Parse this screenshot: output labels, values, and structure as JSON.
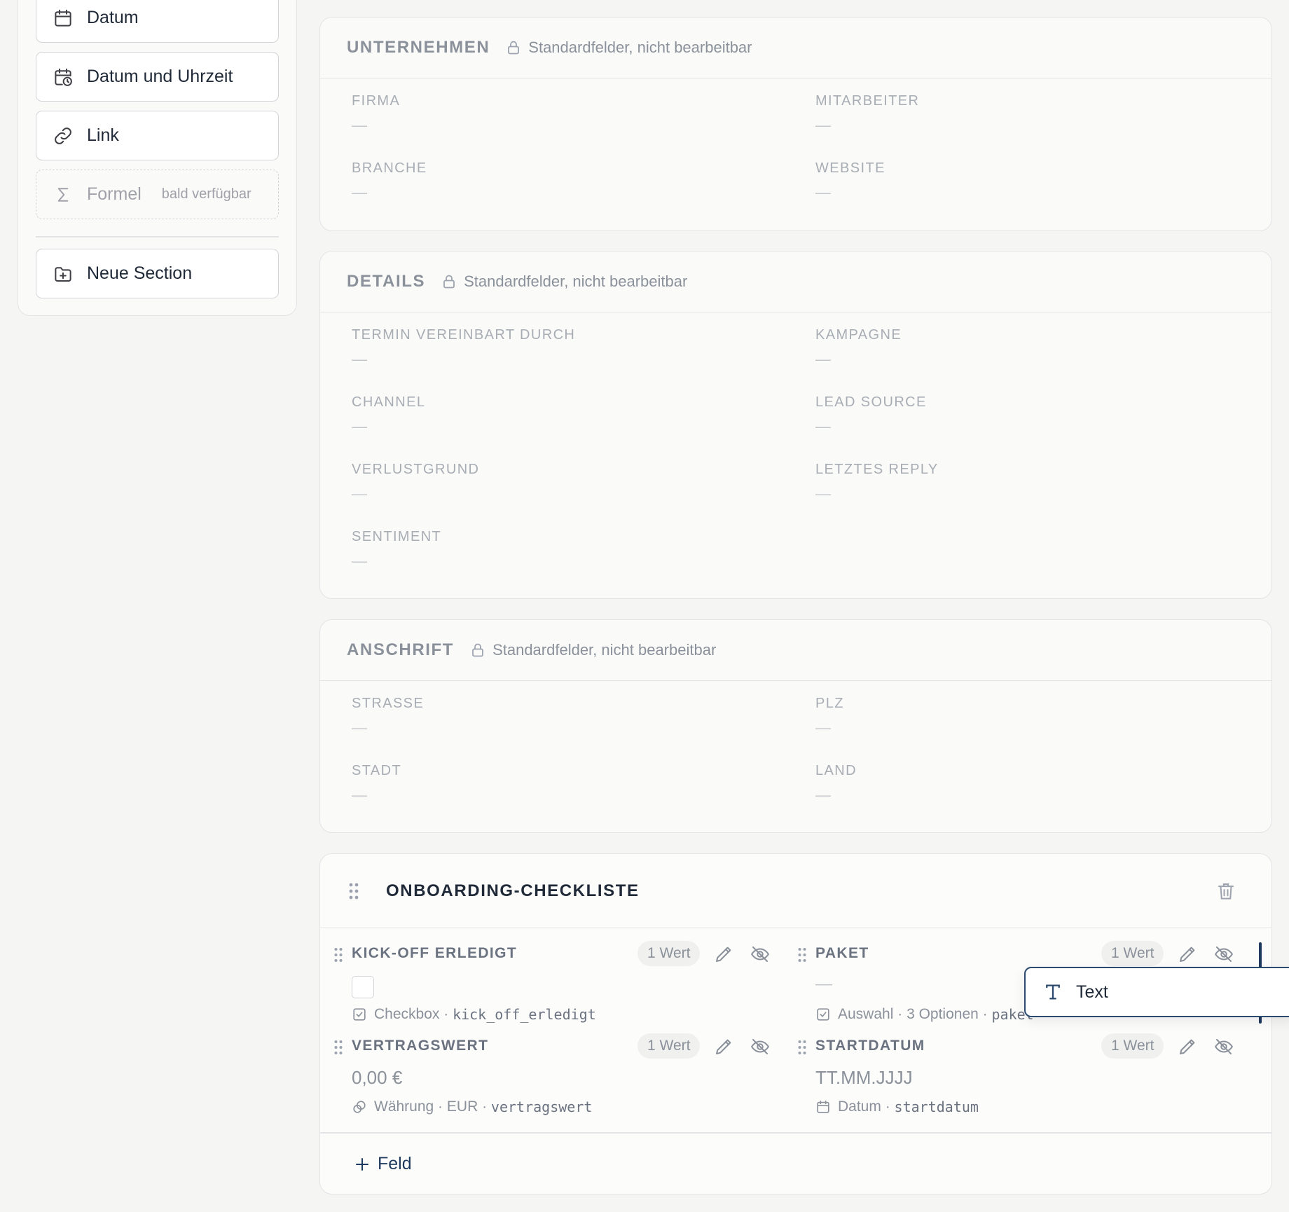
{
  "palette": {
    "items": [
      {
        "label": "Datum",
        "icon": "calendar-icon"
      },
      {
        "label": "Datum und Uhrzeit",
        "icon": "calendar-clock-icon"
      },
      {
        "label": "Link",
        "icon": "link-icon"
      },
      {
        "label": "Formel",
        "icon": "sigma-icon",
        "note": "bald verfügbar"
      }
    ],
    "new_section": {
      "label": "Neue Section",
      "icon": "folder-plus-icon"
    }
  },
  "sections": [
    {
      "title": "UNTERNEHMEN",
      "note": "Standardfelder, nicht bearbeitbar",
      "fields": [
        {
          "label": "FIRMA",
          "value": "—"
        },
        {
          "label": "MITARBEITER",
          "value": "—"
        },
        {
          "label": "BRANCHE",
          "value": "—"
        },
        {
          "label": "WEBSITE",
          "value": "—"
        }
      ]
    },
    {
      "title": "DETAILS",
      "note": "Standardfelder, nicht bearbeitbar",
      "fields": [
        {
          "label": "TERMIN VEREINBART DURCH",
          "value": "—"
        },
        {
          "label": "KAMPAGNE",
          "value": "—"
        },
        {
          "label": "CHANNEL",
          "value": "—"
        },
        {
          "label": "LEAD SOURCE",
          "value": "—"
        },
        {
          "label": "VERLUSTGRUND",
          "value": "—"
        },
        {
          "label": "LETZTES REPLY",
          "value": "—"
        },
        {
          "label": "SENTIMENT",
          "value": "—"
        }
      ]
    },
    {
      "title": "ANSCHRIFT",
      "note": "Standardfelder, nicht bearbeitbar",
      "fields": [
        {
          "label": "STRASSE",
          "value": "—"
        },
        {
          "label": "PLZ",
          "value": "—"
        },
        {
          "label": "STADT",
          "value": "—"
        },
        {
          "label": "LAND",
          "value": "—"
        }
      ]
    }
  ],
  "custom_section": {
    "title": "ONBOARDING-CHECKLISTE",
    "fields": [
      {
        "label": "KICK-OFF ERLEDIGT",
        "badge": "1 Wert",
        "type": "Checkbox",
        "key": "kick_off_erledigt"
      },
      {
        "label": "PAKET",
        "badge": "1 Wert",
        "value": "—",
        "type": "Auswahl",
        "extra": "3 Optionen",
        "key": "paket"
      },
      {
        "label": "VERTRAGSWERT",
        "badge": "1 Wert",
        "value": "0,00 €",
        "type": "Währung",
        "extra": "EUR",
        "key": "vertragswert"
      },
      {
        "label": "STARTDATUM",
        "badge": "1 Wert",
        "value": "TT.MM.JJJJ",
        "type": "Datum",
        "key": "startdatum"
      }
    ],
    "add_label": "Feld"
  },
  "drag_ghost": {
    "label": "Text",
    "icon": "text-type-icon"
  },
  "colors": {
    "accent": "#1e3a5f",
    "muted": "#8b919a",
    "border": "#e4e4e7"
  }
}
